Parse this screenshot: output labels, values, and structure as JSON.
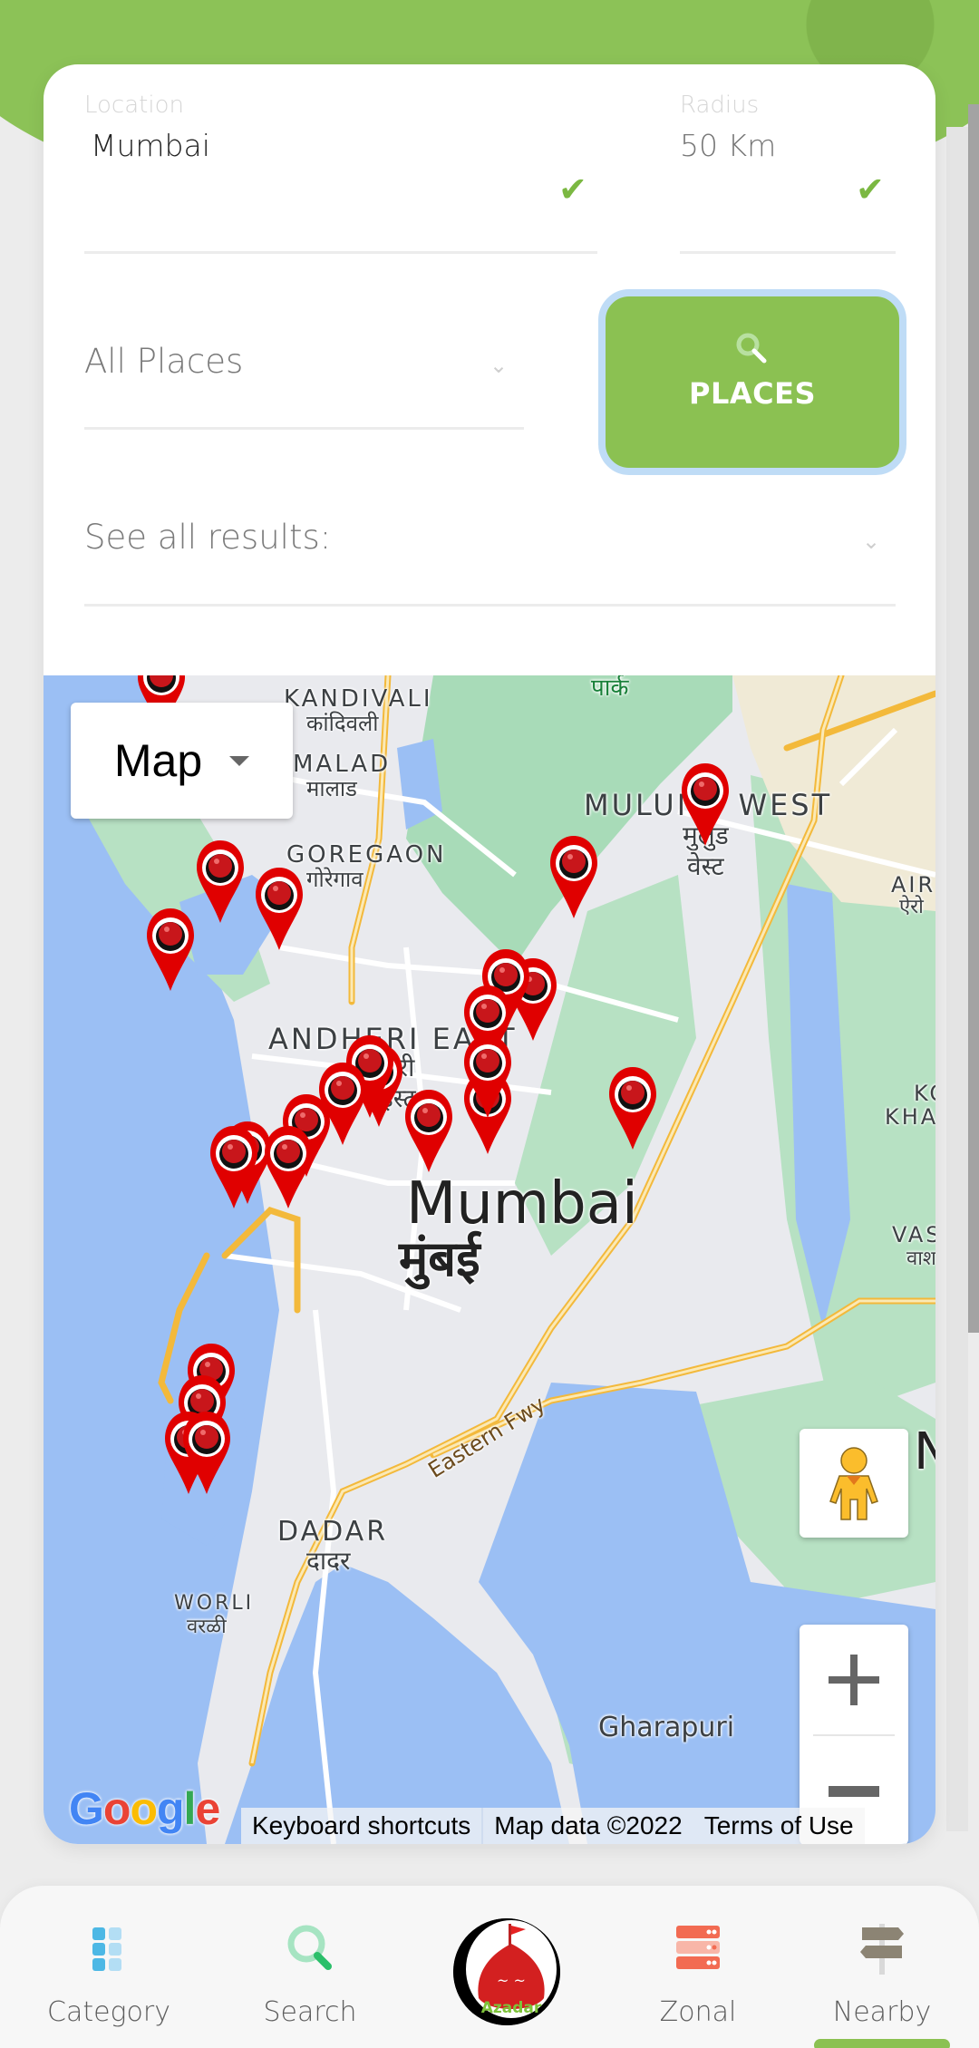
{
  "form": {
    "location_label": "Location",
    "location_value": "Mumbai",
    "radius_label": "Radius",
    "radius_value": "50 Km",
    "category_select": "All Places",
    "places_button": "PLACES",
    "results_select": "See all results:"
  },
  "map": {
    "type_selector": "Map",
    "labels": {
      "kandivali": "KANDIVALI",
      "kandivali_hi": "कांदिवली",
      "malad": "MALAD",
      "malad_hi": "मालाड",
      "goregaon": "GOREGAON",
      "goregaon_hi": "गोरेगाव",
      "park_hi": "पार्क",
      "mulund": "MULUND WEST",
      "mulund_hi1": "मुलुंड",
      "mulund_hi2": "वेस्ट",
      "airoli": "AIR",
      "airoli_hi": "ऐरो",
      "andheri": "ANDHERI EAST",
      "andheri_hi1": "अंधेरी",
      "andheri_hi2": "ईस्ट",
      "kopar": "KO",
      "khairane": "KHA",
      "mumbai": "Mumbai",
      "mumbai_hi": "मुंबई",
      "vashi": "VAS",
      "vashi_hi": "वाश",
      "navi": "Na",
      "eastern_fwy": "Eastern Fwy",
      "dadar": "DADAR",
      "dadar_hi": "दादर",
      "worli": "WORLI",
      "worli_hi": "वरळी",
      "gharapuri": "Gharapuri"
    },
    "marker_count": 24,
    "attribution": {
      "keyboard": "Keyboard shortcuts",
      "map_data": "Map data ©2022",
      "terms": "Terms of Use"
    },
    "google_logo": "Google"
  },
  "nav": {
    "items": [
      {
        "label": "Category",
        "icon": "grid-icon"
      },
      {
        "label": "Search",
        "icon": "search-icon"
      },
      {
        "label": "Azadar",
        "icon": "app-logo"
      },
      {
        "label": "Zonal",
        "icon": "server-stack-icon"
      },
      {
        "label": "Nearby",
        "icon": "signpost-icon"
      }
    ],
    "active": "Nearby",
    "logo_text": "Azadar"
  },
  "colors": {
    "accent_green": "#8bc152",
    "check_green": "#7bb842",
    "marker_red": "#e00000"
  }
}
